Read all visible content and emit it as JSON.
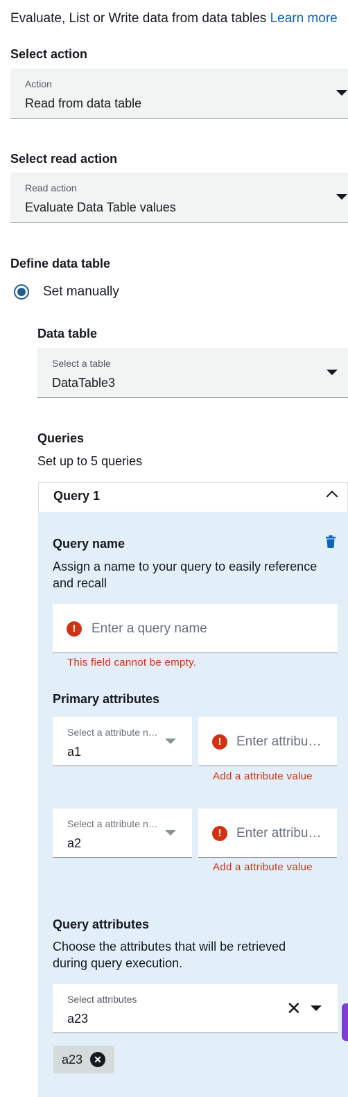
{
  "intro": {
    "text": "Evaluate, List or Write data from data tables",
    "link": "Learn more"
  },
  "select_action": {
    "title": "Select action",
    "field_label": "Action",
    "value": "Read from data table"
  },
  "select_read_action": {
    "title": "Select read action",
    "field_label": "Read action",
    "value": "Evaluate Data Table values"
  },
  "define_table": {
    "title": "Define data table",
    "radio_label": "Set manually"
  },
  "data_table": {
    "title": "Data table",
    "field_label": "Select a table",
    "value": "DataTable3"
  },
  "queries": {
    "title": "Queries",
    "subtitle": "Set up to 5 queries",
    "query": {
      "header": "Query 1",
      "name_title": "Query name",
      "name_desc_line1": "Assign a name to your query to easily reference",
      "name_desc_line2": "and recall",
      "name_placeholder": "Enter a query name",
      "name_error": "This field cannot be empty.",
      "primary_title": "Primary attributes",
      "primary_rows": [
        {
          "select_label": "Select a attribute n…",
          "select_value": "a1",
          "value_placeholder": "Enter attribu…",
          "error": "Add a attribute value"
        },
        {
          "select_label": "Select a attribute n…",
          "select_value": "a2",
          "value_placeholder": "Enter attribu…",
          "error": "Add a attribute value"
        }
      ],
      "query_attr_title": "Query attributes",
      "query_attr_desc_line1": "Choose the attributes that will be retrieved",
      "query_attr_desc_line2": "during query execution.",
      "query_attr_select_label": "Select attributes",
      "query_attr_select_value": "a23",
      "chips": [
        "a23"
      ]
    }
  },
  "icons": {
    "error": "error-icon",
    "trash": "trash-icon",
    "caret": "caret-down-icon",
    "chevron": "chevron-up-icon",
    "clear": "clear-icon",
    "chip_remove": "chip-remove-icon"
  }
}
